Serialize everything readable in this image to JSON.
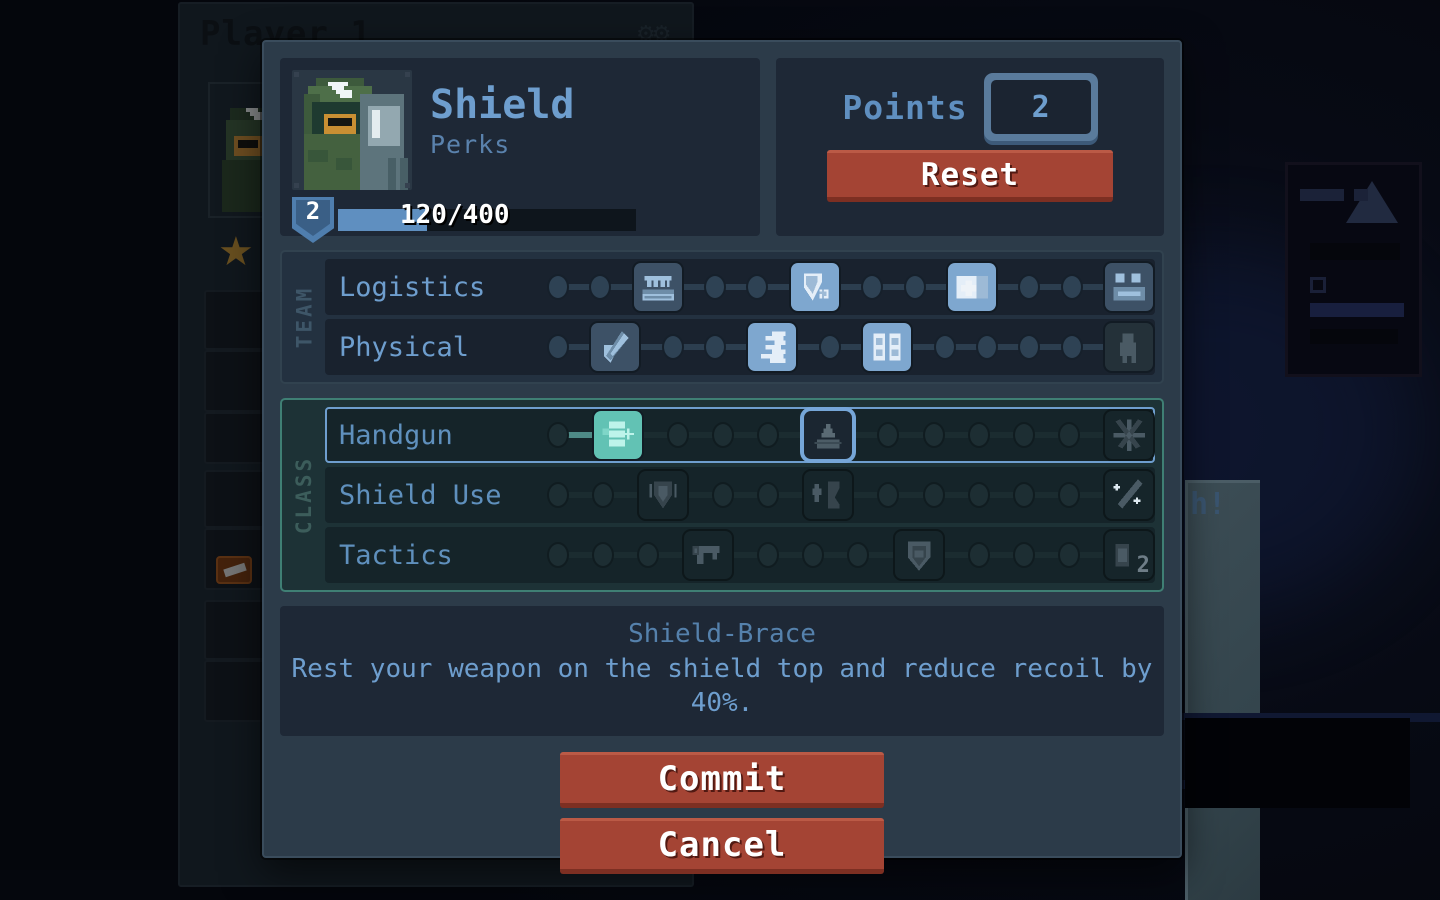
{
  "background": {
    "window_title": "Player 1",
    "gear_icon": "gear-icon",
    "partial_text": "h!",
    "star_icon": "star-icon"
  },
  "modal": {
    "hero": {
      "name": "Shield",
      "subtitle": "Perks",
      "portrait_icon": "soldier-portrait",
      "level": "2",
      "xp_text": "120/400",
      "xp_current": 120,
      "xp_max": 400,
      "xp_percent": 30
    },
    "points": {
      "label": "Points",
      "value": "2",
      "reset_label": "Reset"
    },
    "groups": [
      {
        "label": "TEAM",
        "kind": "team",
        "rows": [
          {
            "name": "Logistics",
            "selected": false,
            "lit_start": false,
            "slots": [
              {
                "type": "node",
                "state": "empty"
              },
              {
                "type": "node",
                "state": "empty"
              },
              {
                "type": "perk",
                "state": "avail",
                "icon": "ammo-crate-icon"
              },
              {
                "type": "node",
                "state": "empty"
              },
              {
                "type": "node",
                "state": "empty"
              },
              {
                "type": "perk",
                "state": "owned",
                "icon": "armor-plate-icon"
              },
              {
                "type": "node",
                "state": "empty"
              },
              {
                "type": "node",
                "state": "empty"
              },
              {
                "type": "perk",
                "state": "owned",
                "icon": "medkit-icon"
              },
              {
                "type": "node",
                "state": "empty"
              },
              {
                "type": "node",
                "state": "empty"
              },
              {
                "type": "perk",
                "state": "avail",
                "icon": "supply-box-icon"
              }
            ]
          },
          {
            "name": "Physical",
            "selected": false,
            "lit_start": false,
            "slots": [
              {
                "type": "node",
                "state": "empty"
              },
              {
                "type": "perk",
                "state": "avail",
                "icon": "knife-shield-icon"
              },
              {
                "type": "node",
                "state": "empty"
              },
              {
                "type": "node",
                "state": "empty"
              },
              {
                "type": "perk",
                "state": "owned",
                "icon": "sprint-icon"
              },
              {
                "type": "node",
                "state": "empty"
              },
              {
                "type": "perk",
                "state": "owned",
                "icon": "backpack-icon"
              },
              {
                "type": "node",
                "state": "empty"
              },
              {
                "type": "node",
                "state": "empty"
              },
              {
                "type": "node",
                "state": "empty"
              },
              {
                "type": "node",
                "state": "empty"
              },
              {
                "type": "perk",
                "state": "locked",
                "icon": "stamina-icon"
              }
            ]
          }
        ]
      },
      {
        "label": "CLASS",
        "kind": "class",
        "rows": [
          {
            "name": "Handgun",
            "selected": true,
            "lit_start": true,
            "slots": [
              {
                "type": "node",
                "state": "lit"
              },
              {
                "type": "perk",
                "state": "teal",
                "icon": "magazine-plus-icon"
              },
              {
                "type": "node",
                "state": "empty"
              },
              {
                "type": "node",
                "state": "empty"
              },
              {
                "type": "node",
                "state": "empty"
              },
              {
                "type": "perk",
                "state": "selected",
                "icon": "shield-brace-icon"
              },
              {
                "type": "node",
                "state": "empty"
              },
              {
                "type": "node",
                "state": "empty"
              },
              {
                "type": "node",
                "state": "empty"
              },
              {
                "type": "node",
                "state": "empty"
              },
              {
                "type": "node",
                "state": "empty"
              },
              {
                "type": "perk",
                "state": "locked",
                "icon": "muzzle-flash-icon"
              }
            ]
          },
          {
            "name": "Shield Use",
            "selected": false,
            "lit_start": false,
            "slots": [
              {
                "type": "node",
                "state": "empty"
              },
              {
                "type": "node",
                "state": "empty"
              },
              {
                "type": "perk",
                "state": "locked",
                "icon": "shield-guard-icon"
              },
              {
                "type": "node",
                "state": "empty"
              },
              {
                "type": "node",
                "state": "empty"
              },
              {
                "type": "perk",
                "state": "locked",
                "icon": "shield-bash-icon"
              },
              {
                "type": "node",
                "state": "empty"
              },
              {
                "type": "node",
                "state": "empty"
              },
              {
                "type": "node",
                "state": "empty"
              },
              {
                "type": "node",
                "state": "empty"
              },
              {
                "type": "node",
                "state": "empty"
              },
              {
                "type": "perk",
                "state": "locked",
                "icon": "shield-repair-icon"
              }
            ]
          },
          {
            "name": "Tactics",
            "selected": false,
            "lit_start": false,
            "slots": [
              {
                "type": "node",
                "state": "empty"
              },
              {
                "type": "node",
                "state": "empty"
              },
              {
                "type": "node",
                "state": "empty"
              },
              {
                "type": "perk",
                "state": "locked",
                "icon": "pistol-icon"
              },
              {
                "type": "node",
                "state": "empty"
              },
              {
                "type": "node",
                "state": "empty"
              },
              {
                "type": "node",
                "state": "empty"
              },
              {
                "type": "perk",
                "state": "locked",
                "icon": "shield-emblem-icon"
              },
              {
                "type": "node",
                "state": "empty"
              },
              {
                "type": "node",
                "state": "empty"
              },
              {
                "type": "node",
                "state": "empty"
              },
              {
                "type": "perk",
                "state": "locked",
                "icon": "double-grenade-icon",
                "badge": "2"
              }
            ]
          }
        ]
      }
    ],
    "description": {
      "title": "Shield-Brace",
      "body": "Rest your weapon on the shield top and reduce recoil by 40%."
    },
    "footer": {
      "commit_label": "Commit",
      "cancel_label": "Cancel"
    }
  },
  "colors": {
    "accent_blue": "#6e9ece",
    "teal": "#62c2b4",
    "red_button": "#a44434",
    "panel_dark": "#1e2836",
    "modal_bg": "#2c3b49"
  }
}
